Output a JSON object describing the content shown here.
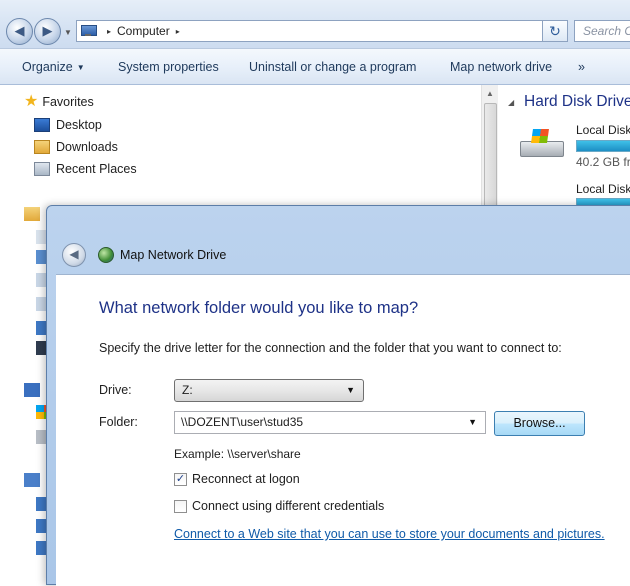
{
  "explorer": {
    "address": {
      "breadcrumb": "Computer",
      "separator": "▸",
      "trailing_separator": "▸"
    },
    "search": {
      "placeholder": "Search C"
    },
    "commands": {
      "organize": "Organize",
      "system_properties": "System properties",
      "uninstall": "Uninstall or change a program",
      "map_drive": "Map network drive",
      "more": "»"
    },
    "nav": {
      "favorites": "Favorites",
      "items": [
        "Desktop",
        "Downloads",
        "Recent Places"
      ]
    },
    "content": {
      "section_title": "Hard Disk Drives",
      "drives": [
        {
          "label": "Local Disk",
          "free": "40.2 GB fr"
        },
        {
          "label": "Local Disk"
        }
      ]
    }
  },
  "dialog": {
    "title": "Map Network Drive",
    "heading": "What network folder would you like to map?",
    "instruction": "Specify the drive letter for the connection and the folder that you want to connect to:",
    "drive_label": "Drive:",
    "drive_value": "Z:",
    "folder_label": "Folder:",
    "folder_value": "\\\\DOZENT\\user\\stud35",
    "browse_label": "Browse...",
    "example": "Example: \\\\server\\share",
    "reconnect_label": "Reconnect at logon",
    "reconnect_checked": true,
    "credentials_label": "Connect using different credentials",
    "credentials_checked": false,
    "link": "Connect to a Web site that you can use to store your documents and pictures."
  },
  "colors": {
    "heading_blue": "#1e3287",
    "link_blue": "#0f5aa8",
    "chrome_blue": "#bcd3ee"
  }
}
